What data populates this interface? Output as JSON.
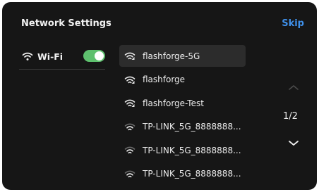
{
  "header": {
    "title": "Network Settings",
    "skip_label": "Skip"
  },
  "wifi": {
    "label": "Wi-Fi",
    "enabled": true
  },
  "networks": [
    {
      "name": "flashforge-5G",
      "signal": "strong",
      "selected": true
    },
    {
      "name": "flashforge",
      "signal": "strong",
      "selected": false
    },
    {
      "name": "flashforge-Test",
      "signal": "strong",
      "selected": false
    },
    {
      "name": "TP-LINK_5G_8888888...",
      "signal": "weak",
      "selected": false
    },
    {
      "name": "TP-LINK_5G_8888888...",
      "signal": "weak",
      "selected": false
    },
    {
      "name": "TP-LINK_5G_8888888...",
      "signal": "weak",
      "selected": false
    }
  ],
  "pagination": {
    "indicator": "1/2",
    "current": 1,
    "total": 2
  },
  "colors": {
    "background": "#161616",
    "accent": "#3f8fe8",
    "toggle_on": "#5ec06e",
    "selected_row": "#2c2c2c"
  }
}
